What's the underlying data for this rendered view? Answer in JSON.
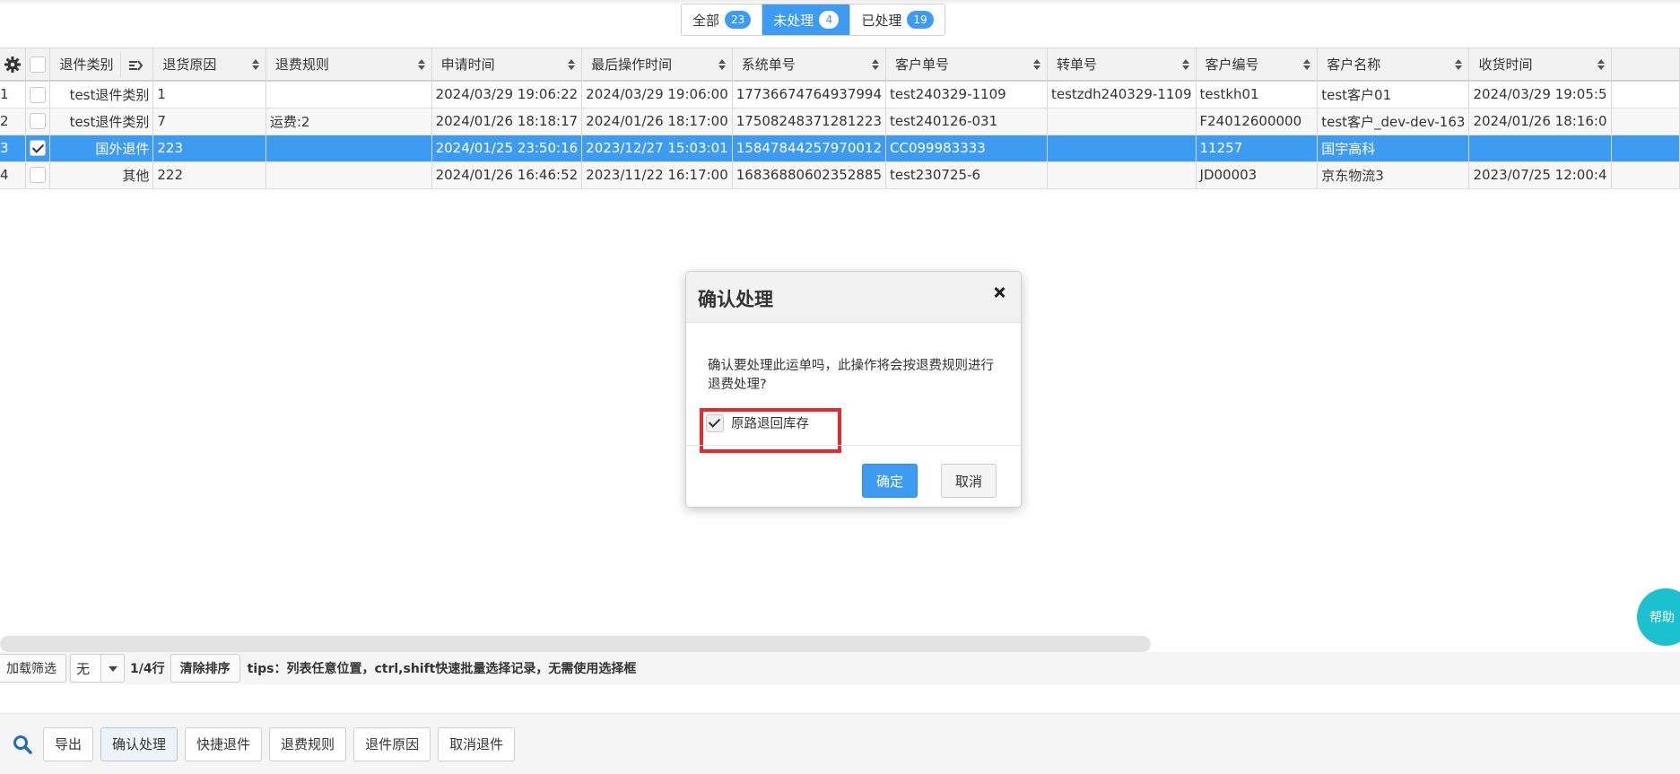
{
  "tabs": [
    {
      "label": "全部",
      "count": "23",
      "active": false
    },
    {
      "label": "未处理",
      "count": "4",
      "active": true
    },
    {
      "label": "已处理",
      "count": "19",
      "active": false
    }
  ],
  "table": {
    "columns": [
      "退件类别",
      "退货原因",
      "退费规则",
      "申请时间",
      "最后操作时间",
      "系统单号",
      "客户单号",
      "转单号",
      "客户编号",
      "客户名称",
      "收货时间"
    ],
    "rows": [
      {
        "no": "1",
        "checked": false,
        "cells": [
          "test退件类别",
          "1",
          "",
          "2024/03/29 19:06:22",
          "2024/03/29 19:06:00",
          "17736674764937994",
          "test240329-1109",
          "testzdh240329-1109",
          "testkh01",
          "test客户01",
          "2024/03/29 19:05:5"
        ]
      },
      {
        "no": "2",
        "checked": false,
        "cells": [
          "test退件类别",
          "7",
          "运费:2",
          "2024/01/26 18:18:17",
          "2024/01/26 18:17:00",
          "17508248371281223",
          "test240126-031",
          "",
          "F24012600000",
          "test客户_dev-dev-163",
          "2024/01/26 18:16:0"
        ]
      },
      {
        "no": "3",
        "checked": true,
        "cells": [
          "国外退件",
          "223",
          "",
          "2024/01/25 23:50:16",
          "2023/12/27 15:03:01",
          "15847844257970012",
          "CC099983333",
          "",
          "11257",
          "国宇高科",
          ""
        ]
      },
      {
        "no": "4",
        "checked": false,
        "cells": [
          "其他",
          "222",
          "",
          "2024/01/26 16:46:52",
          "2023/11/22 16:17:00",
          "16836880602352885",
          "test230725-6",
          "",
          "JD00003",
          "京东物流3",
          "2023/07/25 12:00:4"
        ]
      }
    ]
  },
  "footer": {
    "load_filter": "加载筛选",
    "select_value": "无",
    "row_count": "1/4行",
    "clear_sort": "清除排序",
    "tips": "tips：列表任意位置，ctrl,shift快速批量选择记录，无需使用选择框"
  },
  "actions": [
    "导出",
    "确认处理",
    "快捷退件",
    "退费规则",
    "退件原因",
    "取消退件"
  ],
  "help": "帮助",
  "modal": {
    "title": "确认处理",
    "message": "确认要处理此运单吗，此操作将会按退费规则进行退费处理?",
    "checkbox_label": "原路退回库存",
    "checkbox_checked": true,
    "ok": "确定",
    "cancel": "取消"
  },
  "colors": {
    "primary": "#3d9cf2",
    "highlight": "#e8282c",
    "help": "#1cc1cf"
  }
}
